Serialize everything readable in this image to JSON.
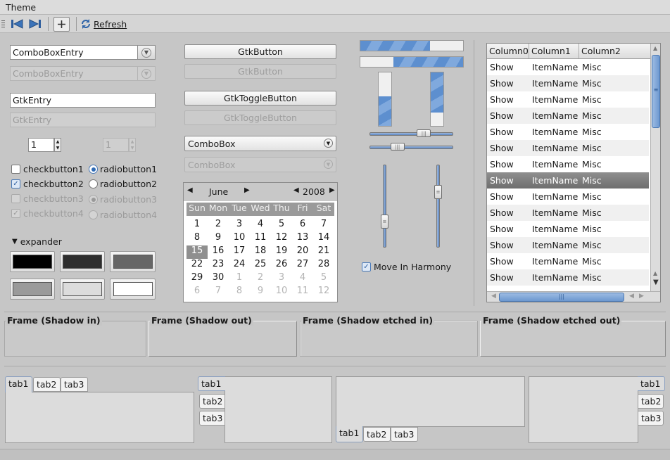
{
  "menu": {
    "title": "Theme"
  },
  "toolbar": {
    "refresh_label": "Refresh"
  },
  "col1": {
    "combo_entry": "ComboBoxEntry",
    "combo_entry_dis": "ComboBoxEntry",
    "entry": "GtkEntry",
    "entry_dis": "GtkEntry",
    "spin_value": "1",
    "spin_value_dis": "1",
    "checks": [
      {
        "label": "checkbutton1",
        "checked": false
      },
      {
        "label": "checkbutton2",
        "checked": true
      },
      {
        "label": "checkbutton3",
        "checked": false
      },
      {
        "label": "checkbutton4",
        "checked": true
      }
    ],
    "radios": [
      {
        "label": "radiobutton1",
        "checked": true
      },
      {
        "label": "radiobutton2",
        "checked": false
      },
      {
        "label": "radiobutton3",
        "checked": true
      },
      {
        "label": "radiobutton4",
        "checked": false
      }
    ],
    "expander": "expander",
    "swatch_colors": [
      "#000000",
      "#2e2e2e",
      "#666666",
      "#9a9a9a",
      "#dcdcdc",
      "#ffffff"
    ]
  },
  "col2": {
    "button": "GtkButton",
    "button_dis": "GtkButton",
    "toggle": "GtkToggleButton",
    "toggle_dis": "GtkToggleButton",
    "combo": "ComboBox",
    "combo_dis": "ComboBox",
    "calendar": {
      "month": "June",
      "year": "2008",
      "days": [
        "Sun",
        "Mon",
        "Tue",
        "Wed",
        "Thu",
        "Fri",
        "Sat"
      ],
      "rows": [
        [
          "1",
          "2",
          "3",
          "4",
          "5",
          "6",
          "7"
        ],
        [
          "8",
          "9",
          "10",
          "11",
          "12",
          "13",
          "14"
        ],
        [
          "15",
          "16",
          "17",
          "18",
          "19",
          "20",
          "21"
        ],
        [
          "22",
          "23",
          "24",
          "25",
          "26",
          "27",
          "28"
        ],
        [
          "29",
          "30",
          "1",
          "2",
          "3",
          "4",
          "5"
        ],
        [
          "6",
          "7",
          "8",
          "9",
          "10",
          "11",
          "12"
        ]
      ],
      "selected": "15"
    }
  },
  "col3": {
    "progress_h": [
      0.68,
      0.32
    ],
    "progress_v": [
      0.55,
      0.75
    ],
    "scale_h": [
      0.68,
      0.3
    ],
    "scale_v": [
      0.72,
      0.3
    ],
    "harmony": "Move In Harmony"
  },
  "tree": {
    "columns": [
      "Column0",
      "Column1",
      "Column2"
    ],
    "rows": [
      [
        "Show",
        "ItemName",
        "Misc"
      ],
      [
        "Show",
        "ItemName",
        "Misc"
      ],
      [
        "Show",
        "ItemName",
        "Misc"
      ],
      [
        "Show",
        "ItemName",
        "Misc"
      ],
      [
        "Show",
        "ItemName",
        "Misc"
      ],
      [
        "Show",
        "ItemName",
        "Misc"
      ],
      [
        "Show",
        "ItemName",
        "Misc"
      ],
      [
        "Show",
        "ItemName",
        "Misc"
      ],
      [
        "Show",
        "ItemName",
        "Misc"
      ],
      [
        "Show",
        "ItemName",
        "Misc"
      ],
      [
        "Show",
        "ItemName",
        "Misc"
      ],
      [
        "Show",
        "ItemName",
        "Misc"
      ],
      [
        "Show",
        "ItemName",
        "Misc"
      ],
      [
        "Show",
        "ItemName",
        "Misc"
      ]
    ],
    "selected_index": 7
  },
  "frames": [
    "Frame (Shadow in)",
    "Frame (Shadow out)",
    "Frame (Shadow etched in)",
    "Frame (Shadow etched out)"
  ],
  "notebooks": {
    "tabs": [
      "tab1",
      "tab2",
      "tab3"
    ]
  }
}
